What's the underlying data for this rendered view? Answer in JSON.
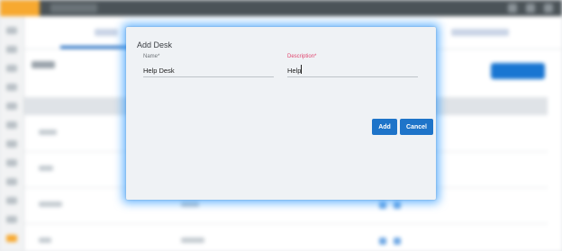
{
  "dialog": {
    "title": "Add Desk",
    "name_label": "Name*",
    "name_value": "Help Desk",
    "description_label": "Description*",
    "description_value": "Help",
    "add_label": "Add",
    "cancel_label": "Cancel"
  },
  "colors": {
    "accent": "#1e74c9",
    "required_label": "#e0456e",
    "focus_glow": "#2896ff",
    "logo": "#f7a930"
  }
}
